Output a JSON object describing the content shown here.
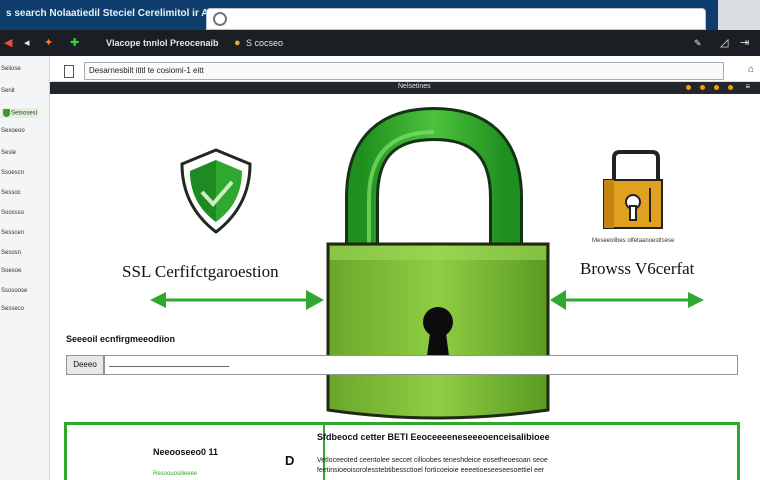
{
  "window": {
    "title": "s search Nolaatiedil Steciel Cerelimitol ir AFIEGTS",
    "search_icon": "search-icon"
  },
  "toolbar": {
    "title": "Vlacope tnnlol Preocenaib",
    "address_hint": "S cocseo"
  },
  "sidebar": {
    "items": [
      {
        "label": "Seliose",
        "active": false
      },
      {
        "label": "Senit",
        "active": false
      },
      {
        "label": "Setsosesl",
        "active": true
      },
      {
        "label": "Sexoeoo",
        "active": false
      },
      {
        "label": "Sesle",
        "active": false
      },
      {
        "label": "Ssoescn",
        "active": false
      },
      {
        "label": "Sessoc",
        "active": false
      },
      {
        "label": "Soossso",
        "active": false
      },
      {
        "label": "Sesscen",
        "active": false
      },
      {
        "label": "Sesosn",
        "active": false
      },
      {
        "label": "Soesoe",
        "active": false
      },
      {
        "label": "Ssosoose",
        "active": false
      },
      {
        "label": "Sesseco",
        "active": false
      }
    ]
  },
  "address": {
    "value": "Desarnesbilt itltl te cosiomi-1 eitt"
  },
  "page_header": {
    "title": "Nelsetines"
  },
  "content": {
    "left_heading": "SSL Cerfifctgaroestion",
    "right_heading": "Browss V6cerfat",
    "right_caption": "Meseeolibes olfetaanoesttsese"
  },
  "search": {
    "label": "Seeeoil ecnfirgmeeodiion",
    "button_label": "Deeeo"
  },
  "bottom_panel": {
    "left_title": "Neeooseeo0 11",
    "left_sub": "Resoouosiiieeee",
    "left_badge": "D",
    "right_heading": "Sfdbeocd cetter BETI Eeoceeeeneseeeoenceisalibioee",
    "right_body": "Vetloceeoted ceentolee seccet cilloobes teneshdeice eosetheoesoan seoe",
    "right_body2": "feetinsioeoisorolesstebtibessctioel forticoeioie eeeetioeseeseesoettiel eer"
  },
  "colors": {
    "accent_green": "#2fa830",
    "lock_green": "#7fc242",
    "title_bar": "#0f3d6e",
    "gold": "#e0a21e"
  },
  "icons": {
    "main": "padlock-icon",
    "left": "shield-check-icon",
    "right": "certificate-lock-icon",
    "arrows": "double-arrow-icon"
  }
}
